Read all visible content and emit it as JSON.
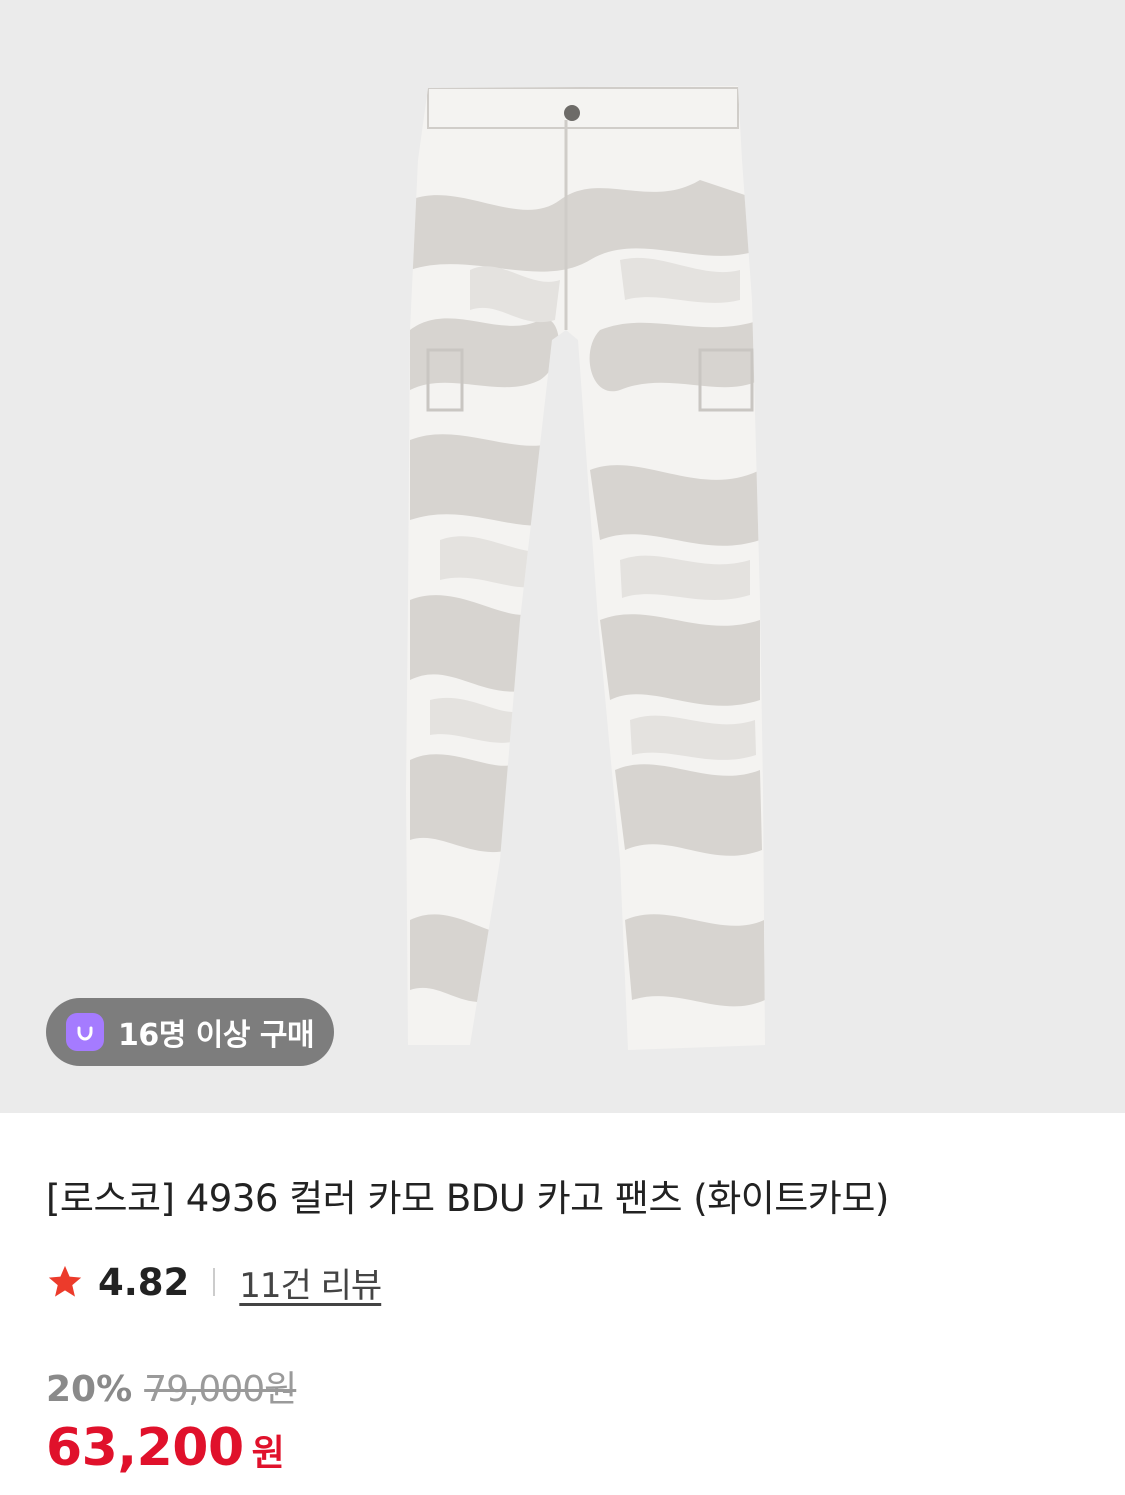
{
  "product": {
    "image": {
      "icon": "camo-cargo-pants-image",
      "background": "#ebebeb"
    },
    "badge": {
      "icon": "shopping-bag-icon",
      "text": "16명 이상 구매",
      "icon_color": "#a57bff"
    },
    "title": "[로스코] 4936 컬러 카모 BDU 카고 팬츠 (화이트카모)",
    "rating": {
      "icon": "star-icon",
      "value": "4.82",
      "star_color": "#ec3b2b"
    },
    "reviews": "11건 리뷰",
    "price": {
      "discount": "20%",
      "original": "79,000원",
      "final": "63,200",
      "currency": "원",
      "accent": "#e0112b"
    }
  }
}
